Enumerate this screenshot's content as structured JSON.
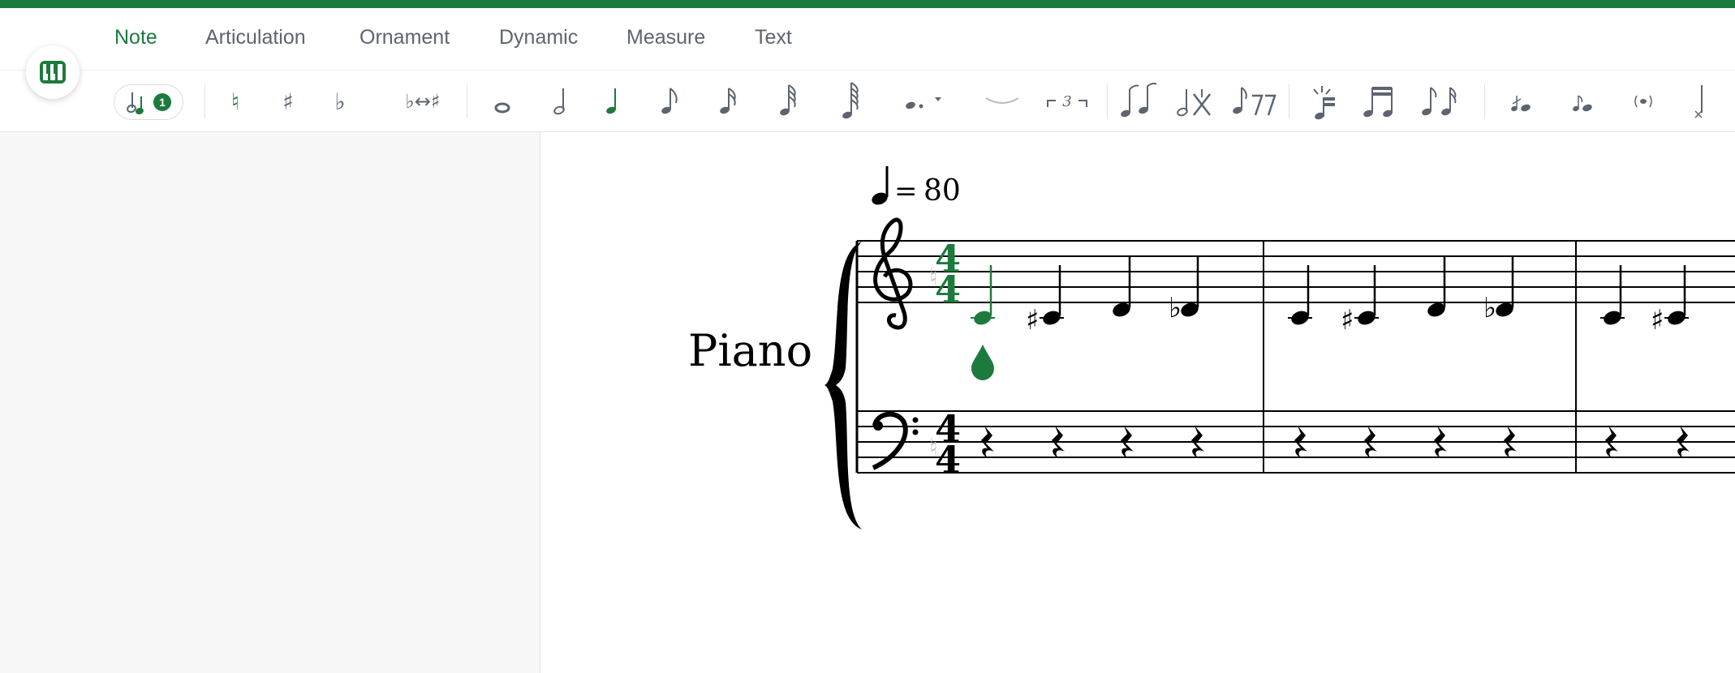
{
  "colors": {
    "accent": "#1d7a3d",
    "text": "#5d6470",
    "staff": "#000000"
  },
  "menu": {
    "tabs": [
      {
        "label": "Note",
        "active": true
      },
      {
        "label": "Articulation"
      },
      {
        "label": "Ornament"
      },
      {
        "label": "Dynamic"
      },
      {
        "label": "Measure"
      },
      {
        "label": "Text"
      }
    ]
  },
  "toolbar": {
    "voice_count": "1",
    "natural": "♮",
    "sharp": "♯",
    "flat": "♭",
    "enharmonic": "♭↔♯",
    "triplet": "3"
  },
  "score": {
    "tempo_value": "80",
    "tempo_eq": "=",
    "instrument": "Piano",
    "time_top": "4",
    "time_bottom": "4"
  }
}
